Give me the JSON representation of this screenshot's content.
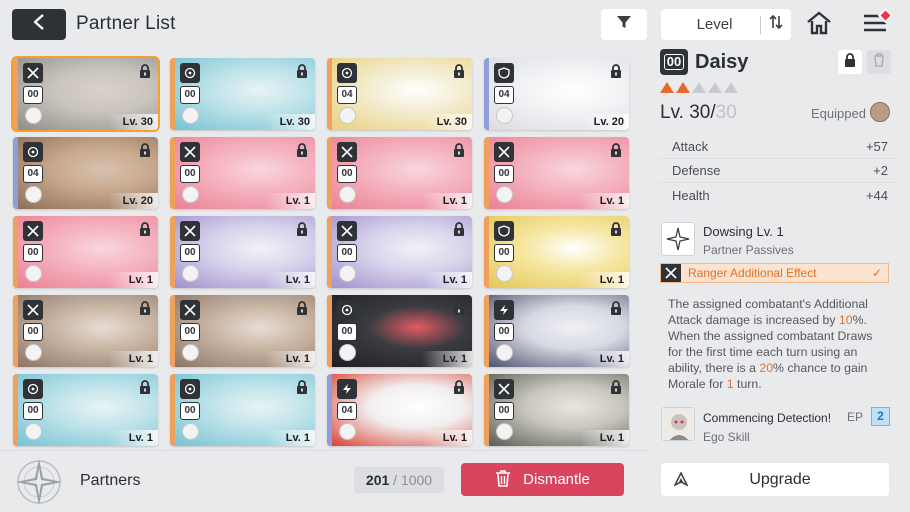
{
  "header": {
    "title": "Partner List",
    "sort_label": "Level"
  },
  "colors": {
    "accent_orange": "#e0722c",
    "dismantle_red": "#d8455c",
    "dark": "#2f3237",
    "selected_outline": "#f5a130"
  },
  "partners": [
    {
      "rank": "00",
      "level": "Lv. 30",
      "class_icon": "cross-swords-icon",
      "strip": "#f0a05a",
      "art": [
        "#c9c4bd",
        "#8e8a86",
        "#d9d2cb"
      ],
      "selected": true
    },
    {
      "rank": "00",
      "level": "Lv. 30",
      "class_icon": "target-icon",
      "strip": "#f0a05a",
      "art": [
        "#bfe3ea",
        "#72c1d1",
        "#e9f3f4"
      ],
      "selected": false
    },
    {
      "rank": "04",
      "level": "Lv. 30",
      "class_icon": "target-icon",
      "strip": "#f0a05a",
      "art": [
        "#f3ecd0",
        "#e8cf78",
        "#ffffff"
      ],
      "selected": false
    },
    {
      "rank": "04",
      "level": "Lv. 20",
      "class_icon": "shield-icon",
      "strip": "#8d9fd6",
      "art": [
        "#f2f3f5",
        "#d9dbe0",
        "#ffffff"
      ],
      "selected": false
    },
    {
      "rank": "04",
      "level": "Lv. 20",
      "class_icon": "target-icon",
      "strip": "#8d9fd6",
      "art": [
        "#c8a98e",
        "#8b6b55",
        "#d8c2b0"
      ],
      "selected": false
    },
    {
      "rank": "00",
      "level": "Lv. 1",
      "class_icon": "cross-swords-icon",
      "strip": "#f0a05a",
      "art": [
        "#f5b3c0",
        "#ea7f93",
        "#f8d7de"
      ],
      "selected": false
    },
    {
      "rank": "00",
      "level": "Lv. 1",
      "class_icon": "cross-swords-icon",
      "strip": "#f0a05a",
      "art": [
        "#f5b3c0",
        "#ea7f93",
        "#f8d7de"
      ],
      "selected": false
    },
    {
      "rank": "00",
      "level": "Lv. 1",
      "class_icon": "cross-swords-icon",
      "strip": "#f0a05a",
      "art": [
        "#f5b3c0",
        "#ea7f93",
        "#f8d7de"
      ],
      "selected": false
    },
    {
      "rank": "00",
      "level": "Lv. 1",
      "class_icon": "cross-swords-icon",
      "strip": "#f0a05a",
      "art": [
        "#f5b3c0",
        "#ea7f93",
        "#f8d7de"
      ],
      "selected": false
    },
    {
      "rank": "00",
      "level": "Lv. 1",
      "class_icon": "cross-swords-icon",
      "strip": "#f0a05a",
      "art": [
        "#d9d4ec",
        "#9e8fcc",
        "#f2f1f6"
      ],
      "selected": false
    },
    {
      "rank": "00",
      "level": "Lv. 1",
      "class_icon": "cross-swords-icon",
      "strip": "#f0a05a",
      "art": [
        "#d9d4ec",
        "#9e8fcc",
        "#f2f1f6"
      ],
      "selected": false
    },
    {
      "rank": "00",
      "level": "Lv. 1",
      "class_icon": "shield-icon",
      "strip": "#f0a05a",
      "art": [
        "#f6e7a3",
        "#e3c552",
        "#ffffff"
      ],
      "selected": false
    },
    {
      "rank": "00",
      "level": "Lv. 1",
      "class_icon": "cross-swords-icon",
      "strip": "#f0a05a",
      "art": [
        "#c9b5a4",
        "#8a7262",
        "#e7ddd5"
      ],
      "selected": false
    },
    {
      "rank": "00",
      "level": "Lv. 1",
      "class_icon": "cross-swords-icon",
      "strip": "#f0a05a",
      "art": [
        "#c9b5a4",
        "#8a7262",
        "#e7ddd5"
      ],
      "selected": false
    },
    {
      "rank": "00",
      "level": "Lv. 1",
      "class_icon": "target-icon",
      "strip": "#f0a05a",
      "art": [
        "#3a3c42",
        "#1d1e22",
        "#e35a64"
      ],
      "selected": false
    },
    {
      "rank": "00",
      "level": "Lv. 1",
      "class_icon": "bolt-icon",
      "strip": "#f0a05a",
      "art": [
        "#d7d9e3",
        "#4a4d6b",
        "#f1f1f4"
      ],
      "selected": false
    },
    {
      "rank": "00",
      "level": "Lv. 1",
      "class_icon": "target-icon",
      "strip": "#f0a05a",
      "art": [
        "#bfe3ea",
        "#72c1d1",
        "#e9f3f4"
      ],
      "selected": false
    },
    {
      "rank": "00",
      "level": "Lv. 1",
      "class_icon": "target-icon",
      "strip": "#f0a05a",
      "art": [
        "#bfe3ea",
        "#72c1d1",
        "#e9f3f4"
      ],
      "selected": false
    },
    {
      "rank": "04",
      "level": "Lv. 1",
      "class_icon": "bolt-icon",
      "strip": "#8d9fd6",
      "art": [
        "#f1eeee",
        "#d93a2b",
        "#ffffff"
      ],
      "selected": false
    },
    {
      "rank": "00",
      "level": "Lv. 1",
      "class_icon": "cross-swords-icon",
      "strip": "#f0a05a",
      "art": [
        "#c8c6be",
        "#55584f",
        "#e8e6e0"
      ],
      "selected": false
    }
  ],
  "footer": {
    "section_label": "Partners",
    "count_current": "201",
    "count_max": "/ 1000",
    "dismantle_label": "Dismantle",
    "upgrade_label": "Upgrade"
  },
  "detail": {
    "rank": "00",
    "name": "Daisy",
    "stars_filled": 2,
    "stars_total": 5,
    "level_current": "Lv. 30/",
    "level_max": "30",
    "equipped_label": "Equipped",
    "stats": [
      {
        "label": "Attack",
        "value": "+57"
      },
      {
        "label": "Defense",
        "value": "+2"
      },
      {
        "label": "Health",
        "value": "+44"
      }
    ],
    "passive_title": "Dowsing Lv. 1",
    "passive_sub": "Partner Passives",
    "effect_label": "Ranger Additional Effect",
    "effect_check": "✓",
    "desc_1": "The assigned combatant's Additional Attack damage is increased by ",
    "desc_2": "10",
    "desc_3": "%. When the assigned combatant Draws for the first time each turn using an ability, there is a ",
    "desc_4": "20",
    "desc_5": "% chance to gain Morale for ",
    "desc_6": "1",
    "desc_7": " turn.",
    "ego_title": "Commencing Detection!",
    "ego_sub": "Ego Skill",
    "ep_label": "EP",
    "ep_value": "2"
  }
}
